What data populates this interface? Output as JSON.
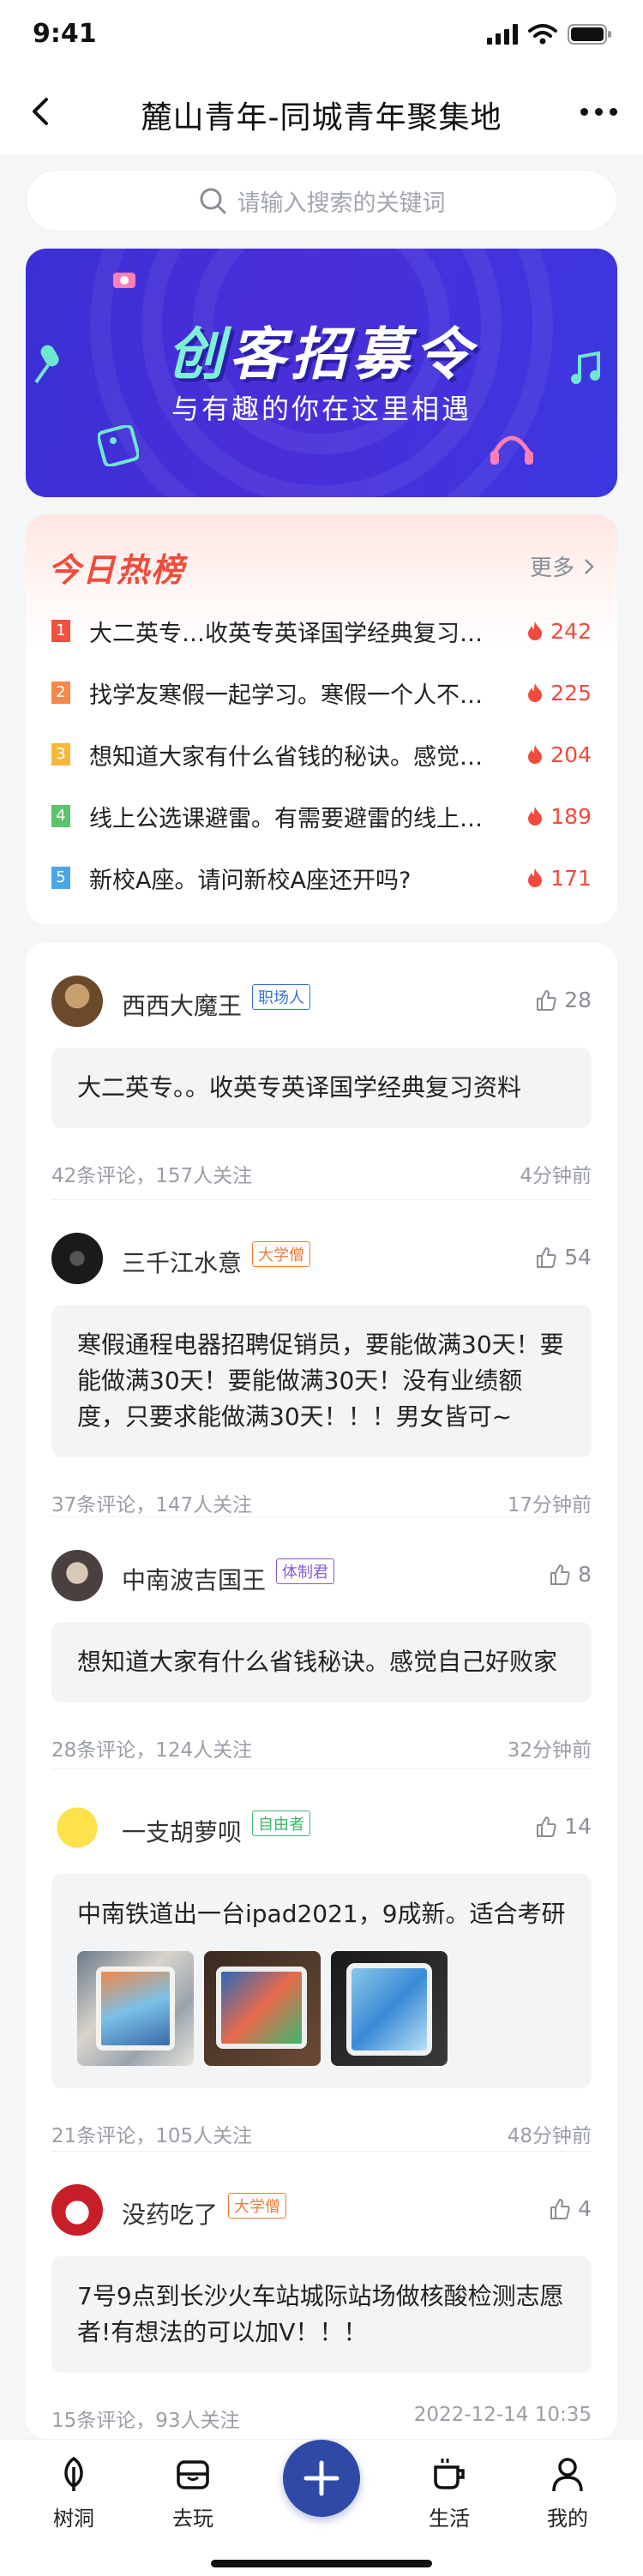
{
  "status": {
    "time": "9:41"
  },
  "nav": {
    "title": "麓山青年-同城青年聚集地"
  },
  "search": {
    "placeholder": "请输入搜索的关键词"
  },
  "banner": {
    "title_a": "创",
    "title_b": "客招募令",
    "subtitle": "与有趣的你在这里相遇"
  },
  "hot": {
    "title": "今日热榜",
    "more": "更多",
    "items": [
      {
        "rank": "1",
        "text": "大二英专…收英专英译国学经典复习…",
        "count": "242",
        "color": "#f0523f"
      },
      {
        "rank": "2",
        "text": "找学友寒假一起学习。寒假一个人不…",
        "count": "225",
        "color": "#f5874a"
      },
      {
        "rank": "3",
        "text": "想知道大家有什么省钱的秘诀。感觉…",
        "count": "204",
        "color": "#f7b83a"
      },
      {
        "rank": "4",
        "text": "线上公选课避雷。有需要避雷的线上…",
        "count": "189",
        "color": "#5cc46a"
      },
      {
        "rank": "5",
        "text": "新校A座。请问新校A座还开吗?",
        "count": "171",
        "color": "#4aa6e8"
      }
    ]
  },
  "posts": [
    {
      "name": "西西大魔王",
      "badge": "职场人",
      "badge_color": "#3a6fd8",
      "likes": "28",
      "content": "大二英专。。收英专英译国学经典复习资料",
      "meta": "42条评论，157人关注",
      "time": "4分钟前"
    },
    {
      "name": "三千江水意",
      "badge": "大学僧",
      "badge_color": "#f07a3a",
      "likes": "54",
      "content": "寒假通程电器招聘促销员，要能做满30天！要能做满30天！要能做满30天！没有业绩额度，只要求能做满30天！！！男女皆可~",
      "meta": "37条评论，147人关注",
      "time": "17分钟前"
    },
    {
      "name": "中南波吉国王",
      "badge": "体制君",
      "badge_color": "#8a5ad8",
      "likes": "8",
      "content": "想知道大家有什么省钱秘诀。感觉自己好败家",
      "meta": "28条评论，124人关注",
      "time": "32分钟前"
    },
    {
      "name": "一支胡萝呗",
      "badge": "自由者",
      "badge_color": "#3db86a",
      "likes": "14",
      "content": "中南铁道出一台ipad2021，9成新。适合考研",
      "meta": "21条评论，105人关注",
      "time": "48分钟前"
    },
    {
      "name": "没药吃了",
      "badge": "大学僧",
      "badge_color": "#f07a3a",
      "likes": "4",
      "content": "7号9点到长沙火车站城际站场做核酸检测志愿者!有想法的可以加V！！！",
      "meta": "15条评论，93人关注",
      "time": "2022-12-14 10:35"
    }
  ],
  "tabs": [
    {
      "label": "树洞",
      "icon": "tree-icon"
    },
    {
      "label": "去玩",
      "icon": "play-icon"
    },
    {
      "label": "",
      "icon": "plus-icon"
    },
    {
      "label": "生活",
      "icon": "coffee-icon"
    },
    {
      "label": "我的",
      "icon": "user-icon"
    }
  ]
}
